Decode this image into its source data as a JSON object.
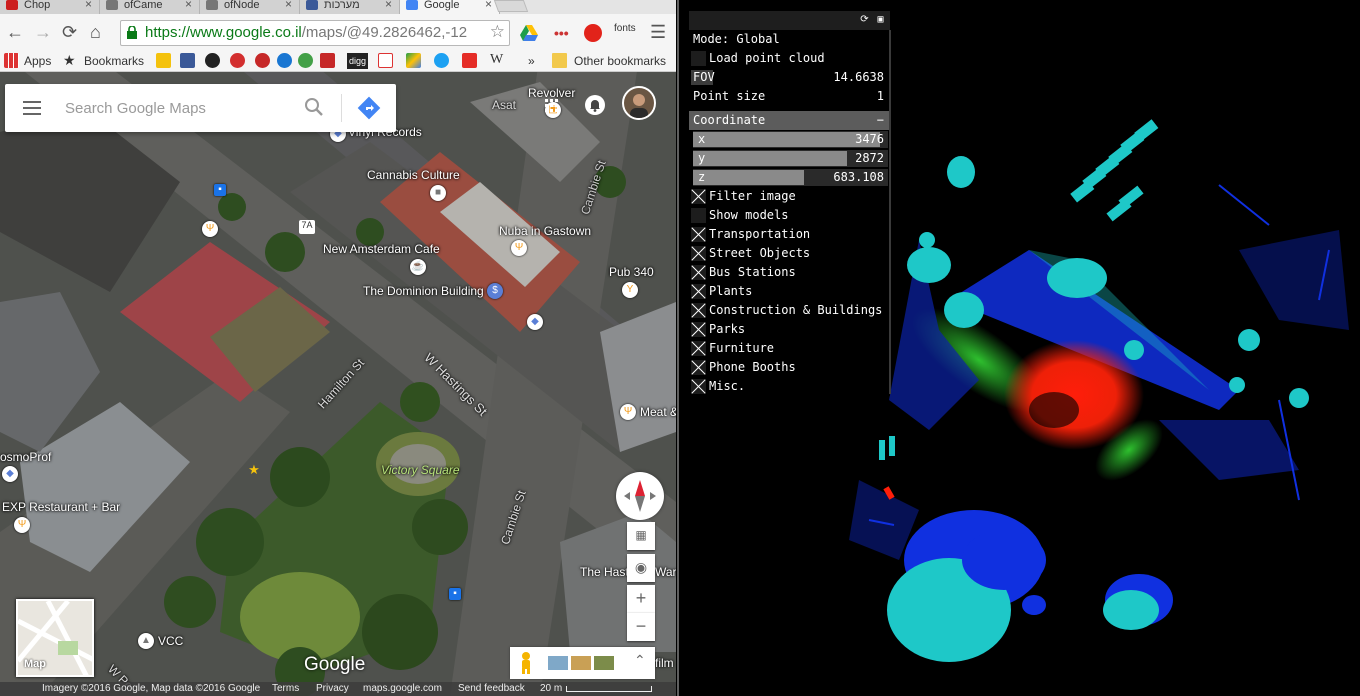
{
  "browser": {
    "tabs": [
      {
        "title": "Chop",
        "color": "#cc1e1e"
      },
      {
        "title": "ofCame",
        "color": "#555555"
      },
      {
        "title": "ofNode",
        "color": "#555555"
      },
      {
        "title": "מערכות",
        "color": "#3b5998"
      },
      {
        "title": "Google",
        "color": "#4285f4"
      }
    ],
    "url_host": "https://www.google.co.il",
    "url_path": "/maps/@49.2826462,-12",
    "fonts_ext": "fonts",
    "bookmarks": {
      "apps": "Apps",
      "bookmarks": "Bookmarks",
      "digg": "digg",
      "other": "Other bookmarks",
      "overflow": "»"
    }
  },
  "map": {
    "search_placeholder": "Search Google Maps",
    "labels": {
      "revolver": "Revolver",
      "asat": "Asat",
      "vinyl": "Vinyl Records",
      "cannabis": "Cannabis Culture",
      "nuba": "Nuba in Gastown",
      "cambie_top": "Cambie St",
      "new_amsterdam": "New Amsterdam Cafe",
      "pub340": "Pub 340",
      "dominion": "The Dominion Building",
      "hamilton": "Hamilton St",
      "w_hastings": "W Hastings St",
      "meat": "Meat &",
      "victory": "Victory Square",
      "cosmoprof": "osmoProf",
      "exp": "EXP Restaurant + Bar",
      "cambie_bottom": "Cambie St",
      "the_hast": "The Hast",
      "war": "War",
      "vcc": "VCC",
      "w_pe": "W Pe",
      "route_7a": "7A",
      "film": "film"
    },
    "minimap_label": "Map",
    "brand": "Google",
    "footer": {
      "imagery": "Imagery ©2016 Google, Map data ©2016 Google",
      "terms": "Terms",
      "privacy": "Privacy",
      "site": "maps.google.com",
      "feedback": "Send feedback",
      "scale": "20 m"
    }
  },
  "viewer": {
    "gui": {
      "mode": "Mode: Global",
      "load_point_cloud": "Load point cloud",
      "fov_label": "FOV",
      "fov_value": "14.6638",
      "point_size_label": "Point size",
      "point_size_value": "1",
      "coordinate_label": "Coordinate",
      "collapse_symbol": "−",
      "x_label": "x",
      "x_value": "3476",
      "x_fill": 0.96,
      "y_label": "y",
      "y_value": "2872",
      "y_fill": 0.79,
      "z_label": "z",
      "z_value": "683.108",
      "z_fill": 0.57,
      "filter_image": "Filter image",
      "show_models": "Show models",
      "categories": [
        "Transportation",
        "Street Objects",
        "Bus Stations",
        "Plants",
        "Construction & Buildings",
        "Parks",
        "Furniture",
        "Phone Booths",
        "Misc."
      ],
      "toggles": {
        "load_point_cloud": false,
        "filter_image": true,
        "show_models": false,
        "categories": [
          true,
          true,
          true,
          true,
          true,
          true,
          true,
          true,
          true
        ]
      }
    },
    "colors": {
      "cyan": "#1ec8c8",
      "blue": "#1030e0",
      "green": "#2ec02e",
      "red": "#ff1e0a"
    }
  }
}
